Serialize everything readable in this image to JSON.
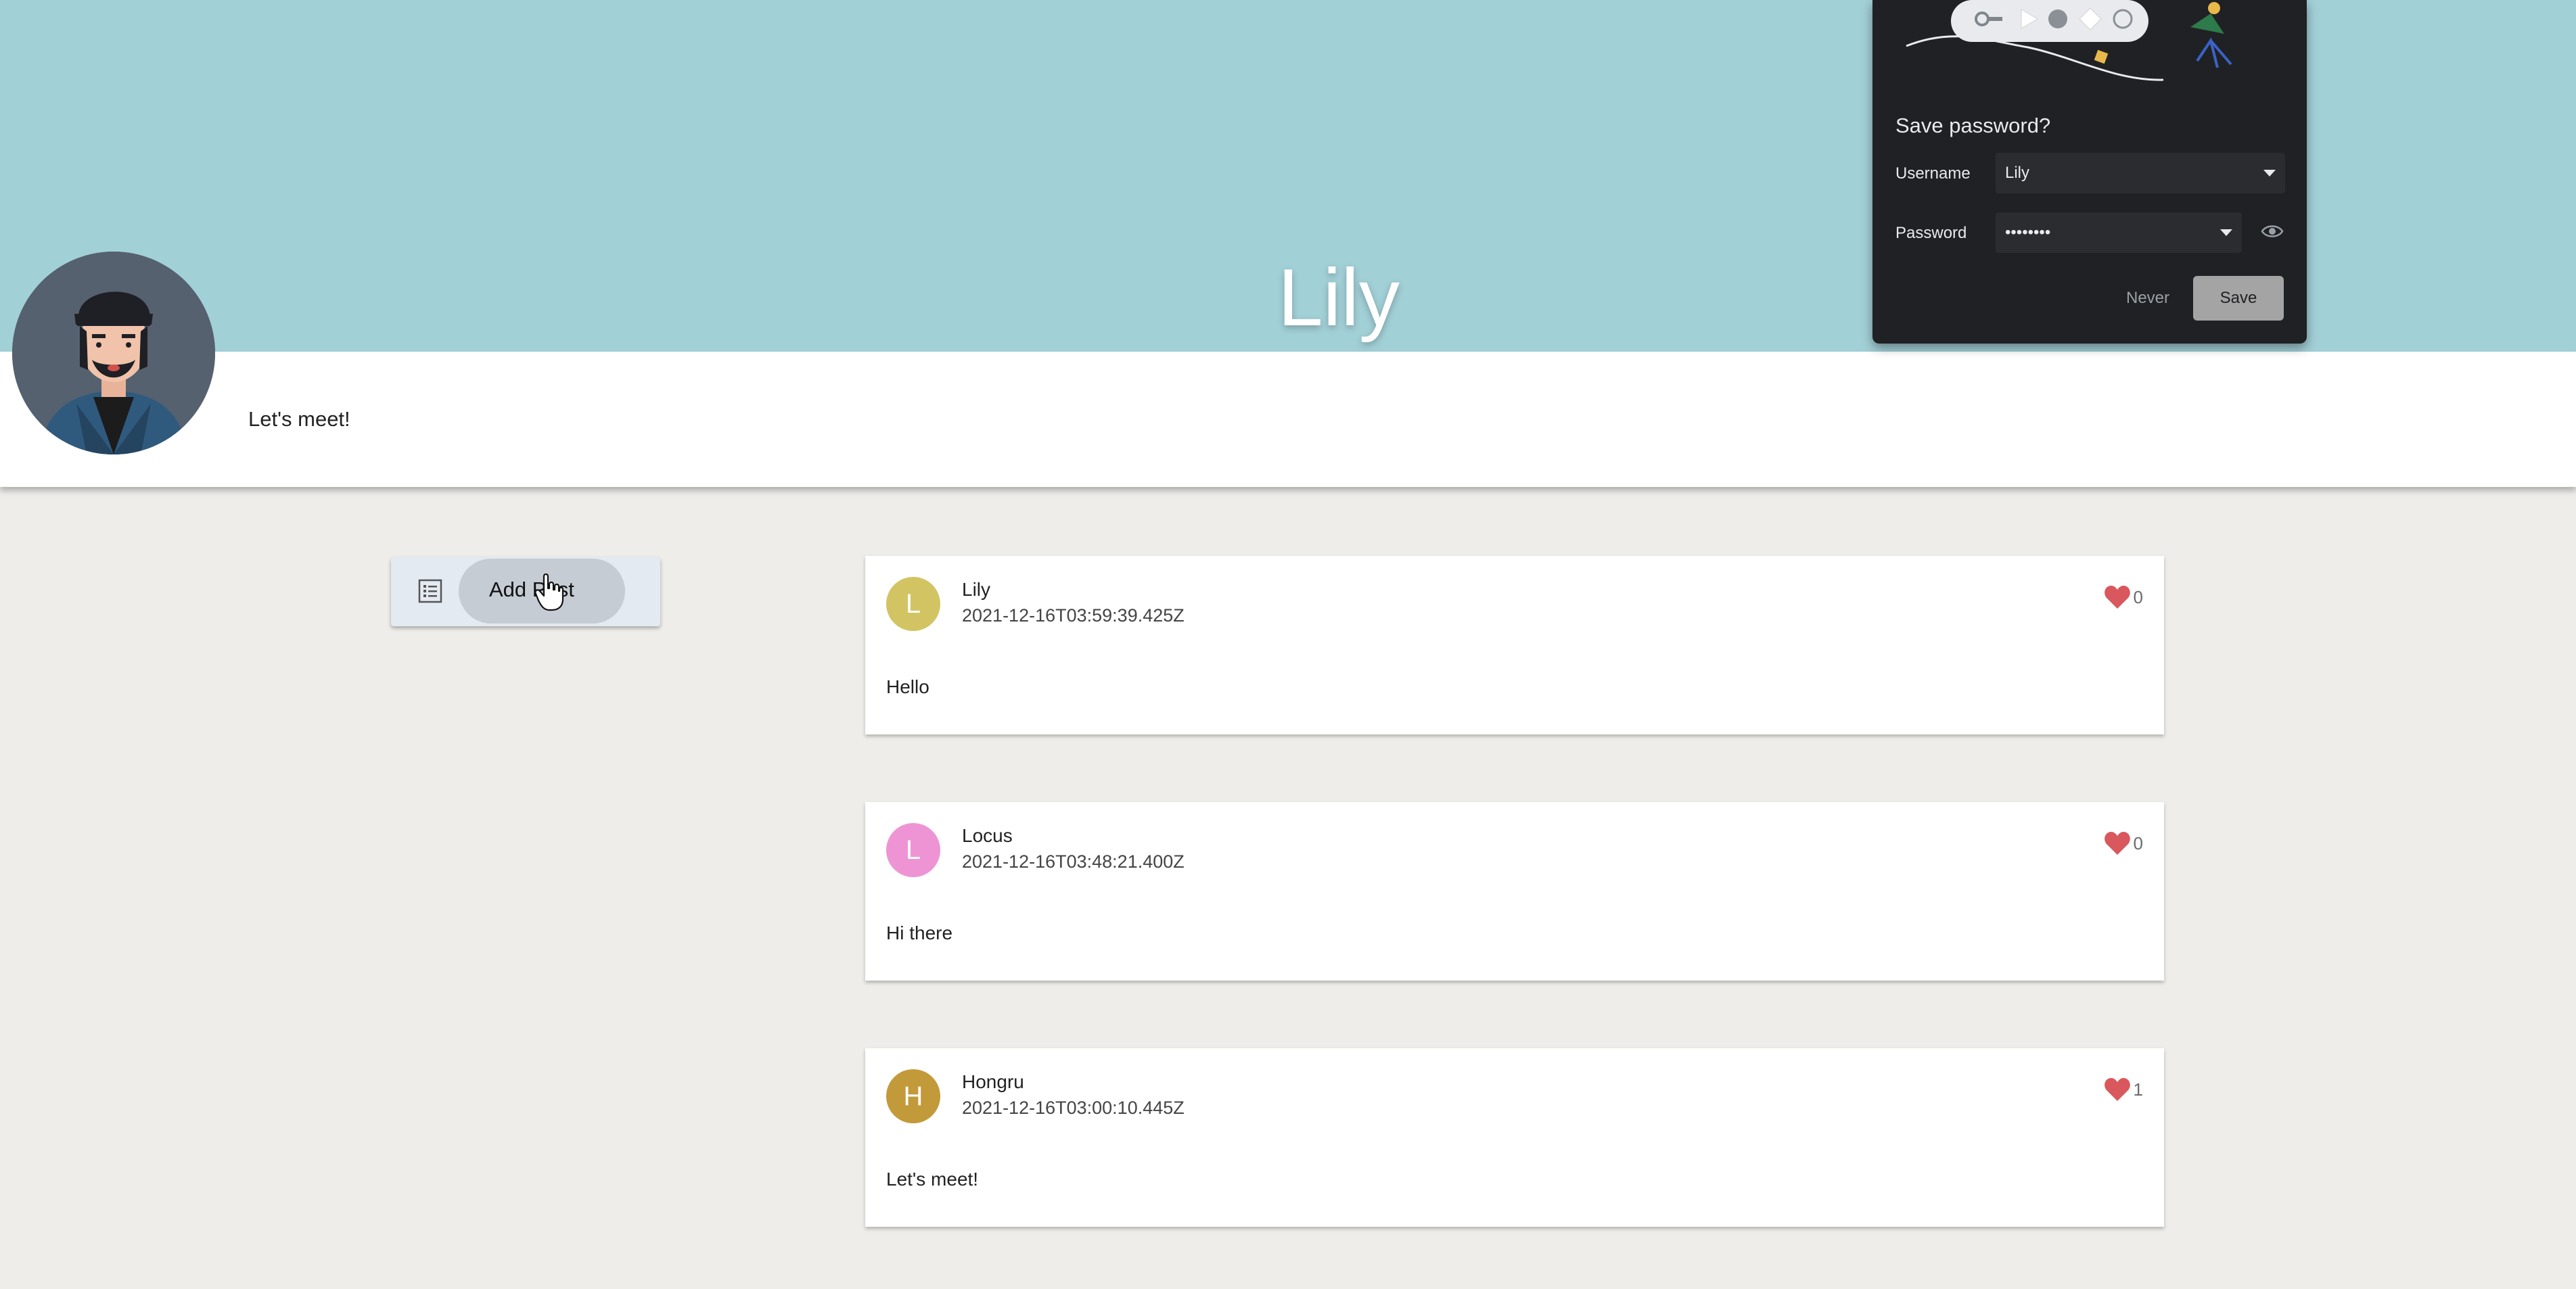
{
  "profile": {
    "name": "Lily",
    "status": "Let's meet!",
    "avatar_icon": "user-avatar-illustration"
  },
  "actions": {
    "add_post_label": "Add Post",
    "add_post_icon": "list-icon"
  },
  "posts": [
    {
      "initial": "L",
      "author": "Lily",
      "timestamp": "2021-12-16T03:59:39.425Z",
      "body": "Hello",
      "likes": "0",
      "avatar_color": "#d2c463"
    },
    {
      "initial": "L",
      "author": "Locus",
      "timestamp": "2021-12-16T03:48:21.400Z",
      "body": "Hi there",
      "likes": "0",
      "avatar_color": "#ee94d5"
    },
    {
      "initial": "H",
      "author": "Hongru",
      "timestamp": "2021-12-16T03:00:10.445Z",
      "body": "Let's meet!",
      "likes": "1",
      "avatar_color": "#c39a3a"
    }
  ],
  "password_prompt": {
    "title": "Save password?",
    "username_label": "Username",
    "username_value": "Lily",
    "password_label": "Password",
    "password_value": "••••••••",
    "never_label": "Never",
    "save_label": "Save"
  },
  "colors": {
    "banner": "#a2d0d7",
    "page_bg": "#efede9",
    "heart": "#d9585d",
    "popup_bg": "#202124"
  }
}
